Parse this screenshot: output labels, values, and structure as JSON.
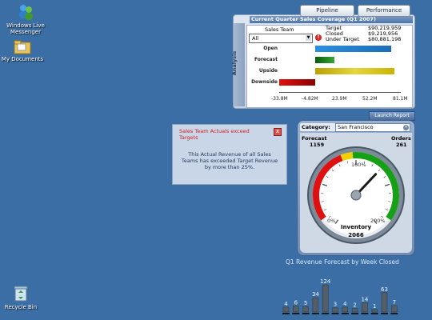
{
  "desktop": {
    "icons": [
      {
        "label": "Windows Live Messenger"
      },
      {
        "label": "My Documents"
      },
      {
        "label": "Recycle Bin"
      }
    ]
  },
  "coverage": {
    "tabs": [
      "Pipeline",
      "Performance"
    ],
    "title": "Current Quarter Sales Coverage (Q1 2007)",
    "side_label": "Analysis",
    "team_label": "Sales Team",
    "team_value": "All",
    "stats": [
      {
        "label": "Target",
        "value": "$90,219,959"
      },
      {
        "label": "Closed",
        "value": "$9,219,956"
      },
      {
        "label": "Under Target",
        "value": "$80,881,198"
      }
    ],
    "launch_label": "Launch Report",
    "colors": {
      "upside": "#c9b400",
      "downside": "#b00000",
      "forecast": "#2a8a2a",
      "open": "#1e7fd0"
    }
  },
  "alert": {
    "title": "Sales Team Actuals exceed Targets",
    "close": "x",
    "body": "This Actual Revenue of all Sales Teams has exceeded Target Revenue by more than 25%."
  },
  "gauge": {
    "category_label": "Category:",
    "category_value": "San Francisco",
    "forecast_label": "Forecast",
    "forecast_value": "1159",
    "orders_label": "Orders",
    "orders_value": "261",
    "scale": [
      "0%",
      "100%",
      "200%"
    ],
    "inventory_label": "Inventory",
    "inventory_value": "2066",
    "needle_percent": 130
  },
  "chart_data": [
    {
      "type": "bar",
      "title": "",
      "xlabel": "",
      "ylabel": "",
      "orientation": "horizontal",
      "categories": [
        "Open",
        "Forecast",
        "Upside",
        "Downside"
      ],
      "values": [
        72000000,
        18000000,
        75000000,
        34000000
      ],
      "xlim": [
        -33800000,
        81100000
      ],
      "tick_labels": [
        "-33.8M",
        "-4.82M",
        "23.9M",
        "52.2M",
        "81.1M"
      ],
      "grid": false
    },
    {
      "type": "bar",
      "title": "Q1 Revenue Forecast by Week Closed",
      "xlabel": "",
      "ylabel": "",
      "values": [
        4,
        6,
        5,
        34,
        124,
        3,
        4,
        2,
        14,
        1,
        63,
        7
      ],
      "grid": false
    }
  ]
}
